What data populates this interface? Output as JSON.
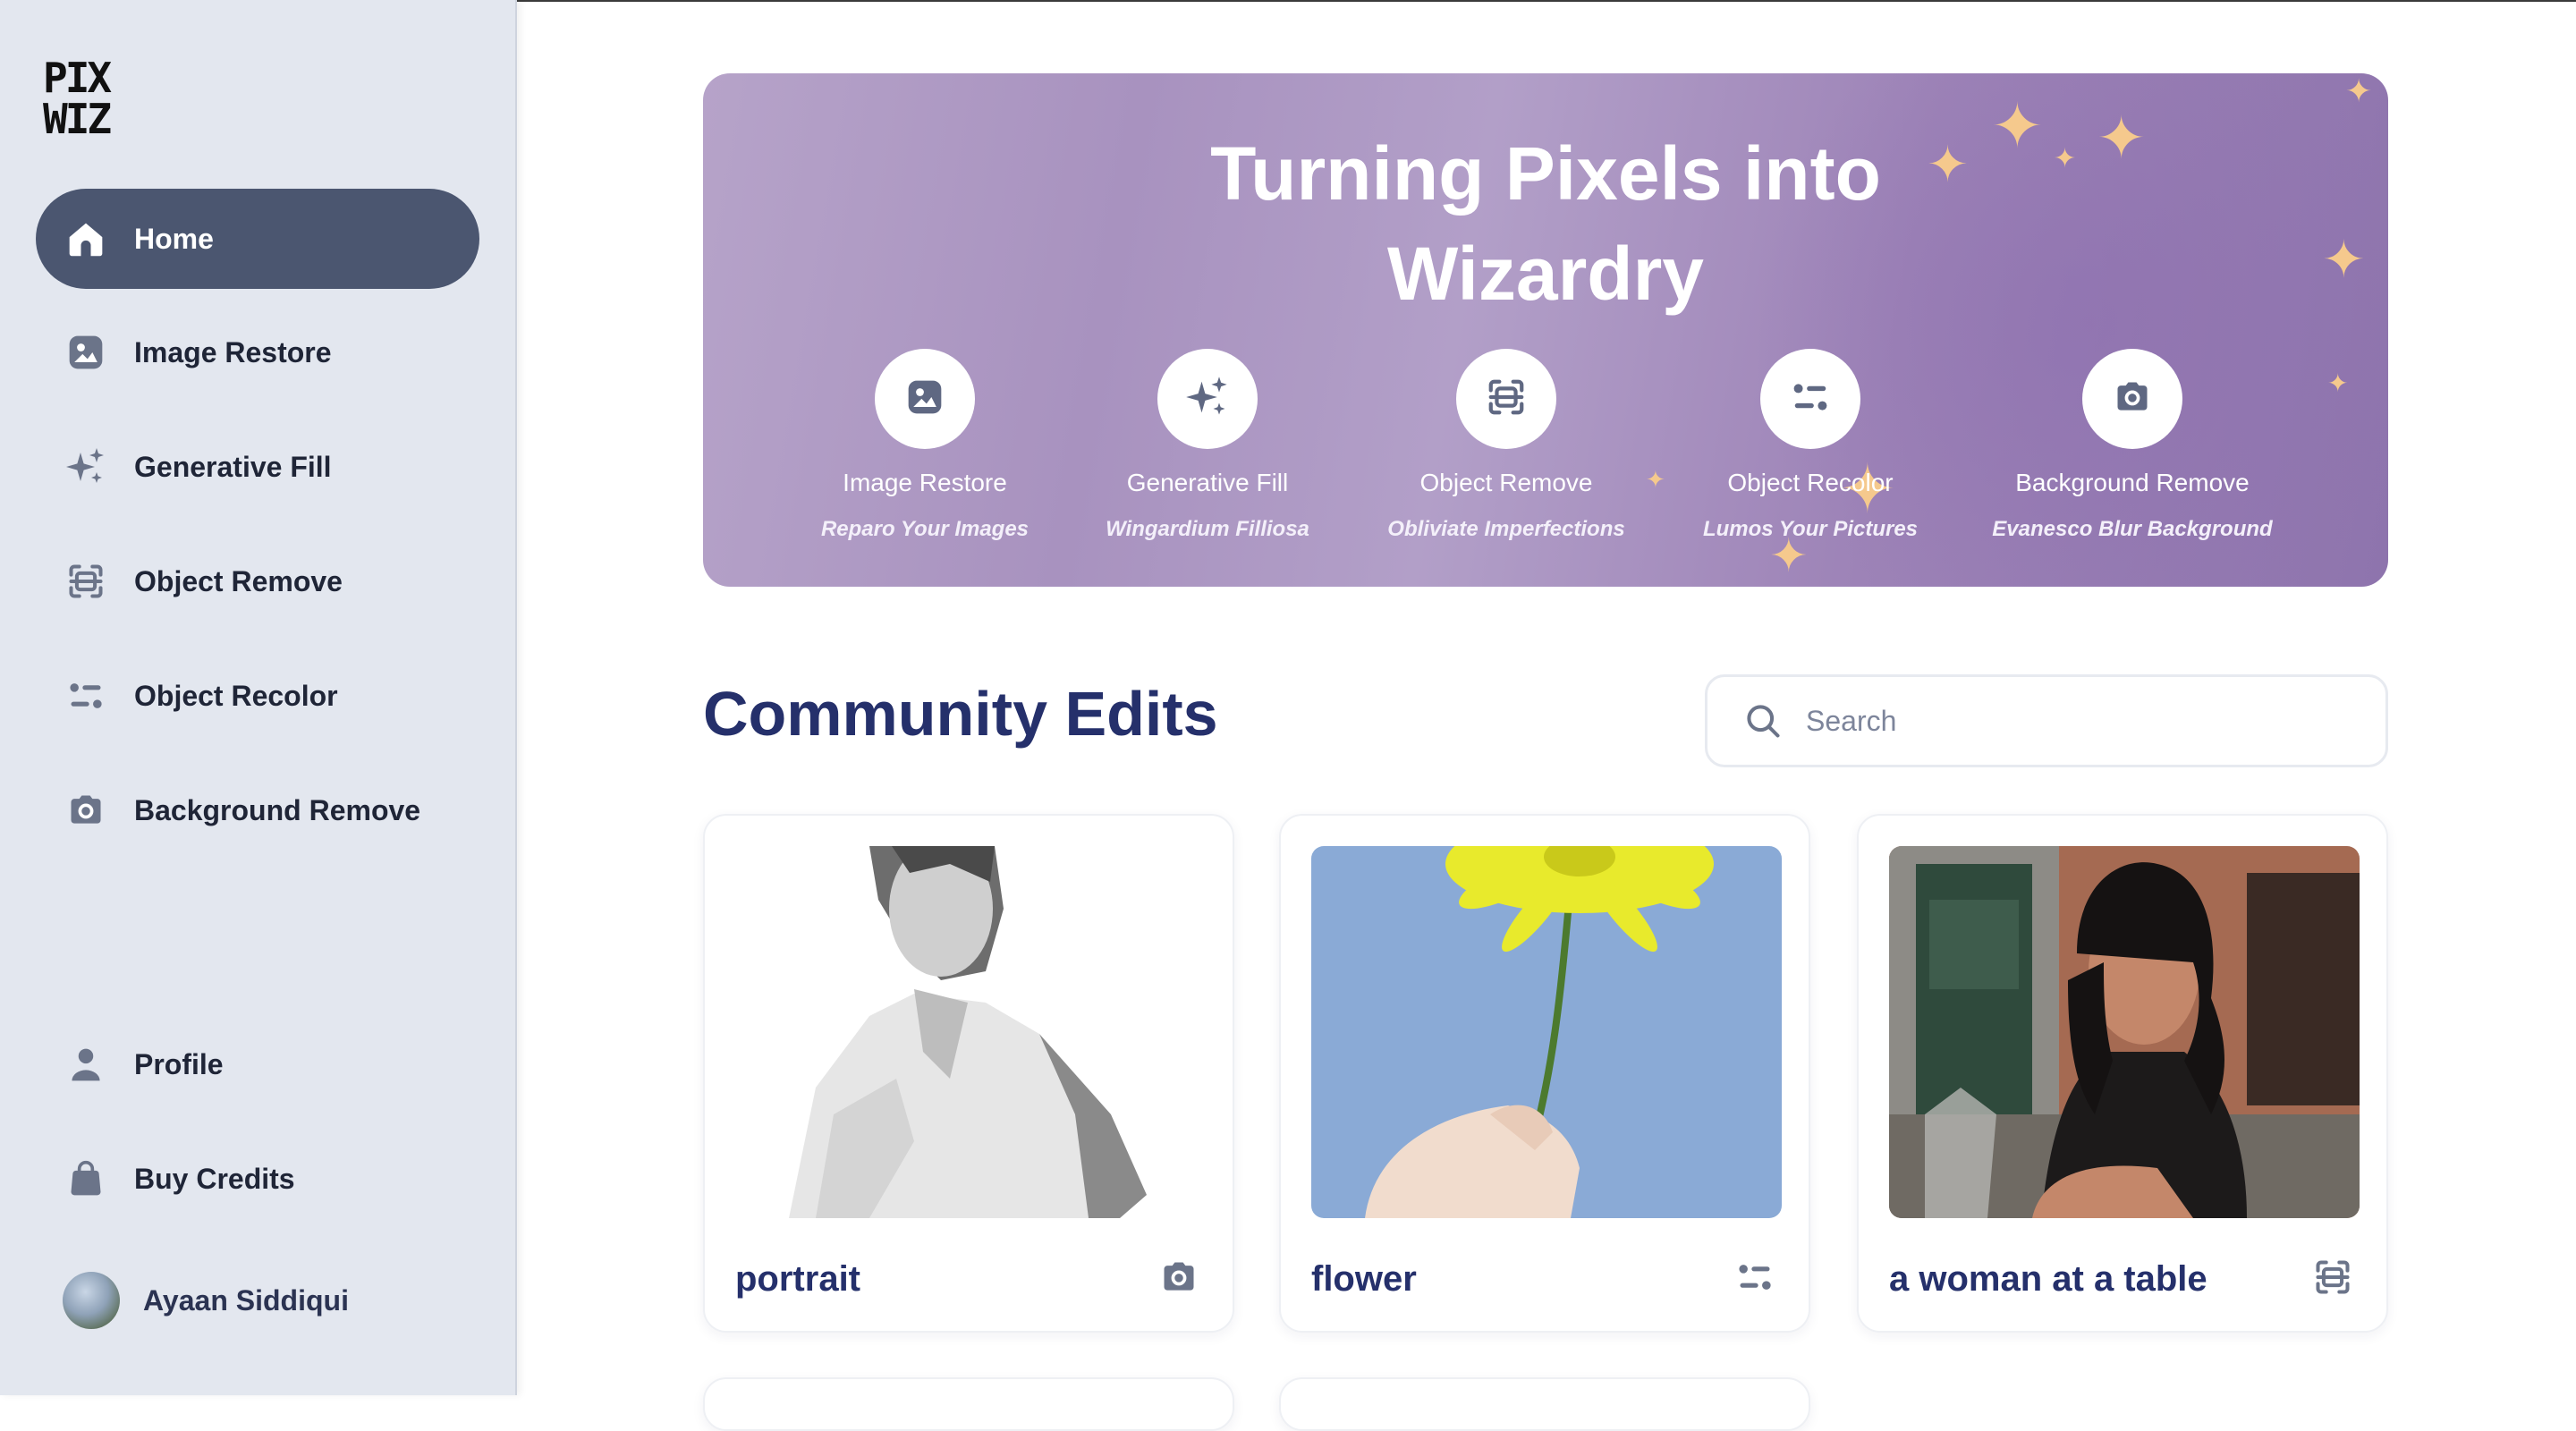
{
  "app": {
    "logo_line1": "PIX",
    "logo_line2": "WIZ"
  },
  "sidebar": {
    "items": [
      {
        "label": "Home",
        "icon": "home-icon",
        "active": true
      },
      {
        "label": "Image Restore",
        "icon": "image-icon"
      },
      {
        "label": "Generative Fill",
        "icon": "sparkles-icon"
      },
      {
        "label": "Object Remove",
        "icon": "scan-icon"
      },
      {
        "label": "Object Recolor",
        "icon": "filter-icon"
      },
      {
        "label": "Background Remove",
        "icon": "camera-icon"
      }
    ],
    "bottom_items": [
      {
        "label": "Profile",
        "icon": "user-icon"
      },
      {
        "label": "Buy Credits",
        "icon": "bag-icon"
      }
    ],
    "user": {
      "name": "Ayaan Siddiqui"
    }
  },
  "banner": {
    "title_line1": "Turning Pixels into",
    "title_line2": "Wizardry",
    "features": [
      {
        "name": "Image Restore",
        "tagline": "Reparo Your Images",
        "icon": "image-icon"
      },
      {
        "name": "Generative Fill",
        "tagline": "Wingardium Filliosa",
        "icon": "sparkles-icon"
      },
      {
        "name": "Object Remove",
        "tagline": "Obliviate Imperfections",
        "icon": "scan-icon"
      },
      {
        "name": "Object Recolor",
        "tagline": "Lumos Your Pictures",
        "icon": "filter-icon"
      },
      {
        "name": "Background Remove",
        "tagline": "Evanesco Blur Background",
        "icon": "camera-icon"
      }
    ]
  },
  "community": {
    "title": "Community Edits",
    "search": {
      "placeholder": "Search",
      "value": ""
    },
    "cards": [
      {
        "name": "portrait",
        "icon": "camera-icon"
      },
      {
        "name": "flower",
        "icon": "filter-icon"
      },
      {
        "name": "a woman at a table",
        "icon": "scan-icon"
      }
    ]
  },
  "colors": {
    "sidebar_bg": "#e3e7ef",
    "active_nav": "#4b5670",
    "heading": "#25306b",
    "banner_purple": "#a892bf",
    "icon_gray": "#6b7489"
  }
}
